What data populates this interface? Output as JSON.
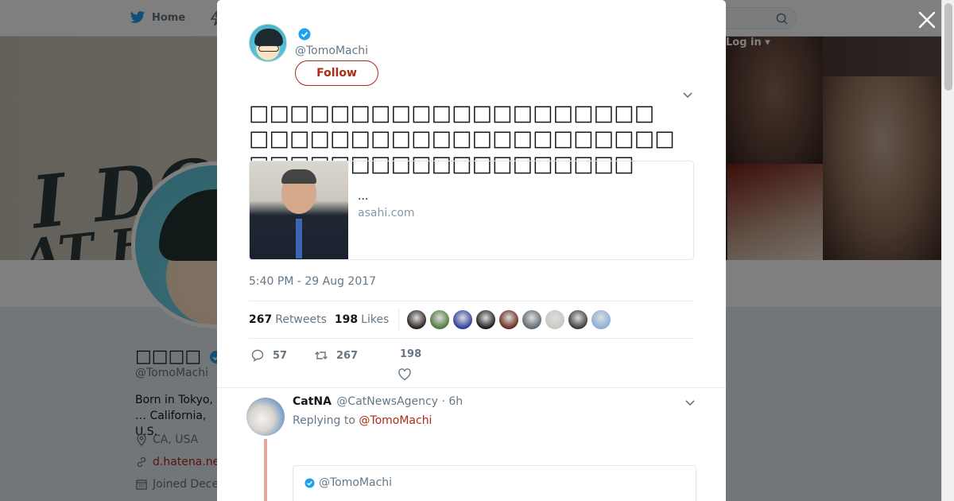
{
  "nav": {
    "home_label": "Home",
    "login_label": "Log in ▾"
  },
  "banner": {
    "line1": "I DON",
    "line2": "AT H"
  },
  "profile": {
    "name": "□□□□",
    "handle": "@TomoMachi",
    "bio": "Born in Tokyo, … California, U.S.",
    "location": "CA, USA",
    "website": "d.hatena.ne",
    "joined": "Joined Dece"
  },
  "tweet": {
    "handle": "@TomoMachi",
    "follow_label": "Follow",
    "text_line1": "□□□□□□□□□□□□□□□□□□□□",
    "text_line2": "□□□□□□□□□□□□□□□□□□□□□□□□□□□□□□□□□□□□□□□□",
    "card": {
      "title": "...",
      "domain": "asahi.com"
    },
    "timestamp": "5:40 PM - 29 Aug 2017",
    "stats": {
      "retweets_count": "267",
      "retweets_label": "Retweets",
      "likes_count": "198",
      "likes_label": "Likes"
    },
    "likers": [
      "#2a2320",
      "#4e7a3d",
      "#2b3f9c",
      "#1c1c1c",
      "#6b2a1f",
      "#5e6a73",
      "#c9c9c2",
      "#3b3b3b",
      "#8ab0d6"
    ],
    "actions": {
      "replies": "57",
      "retweets": "267",
      "likes": "198"
    }
  },
  "reply": {
    "name": "CatNA",
    "handle": "@CatNewsAgency",
    "time": "· 6h",
    "replying_prefix": "Replying to",
    "replying_mention": "@TomoMachi",
    "quote_handle": "@TomoMachi"
  },
  "colors": {
    "accent": "#ab2c17",
    "verified": "#1da1f2"
  }
}
